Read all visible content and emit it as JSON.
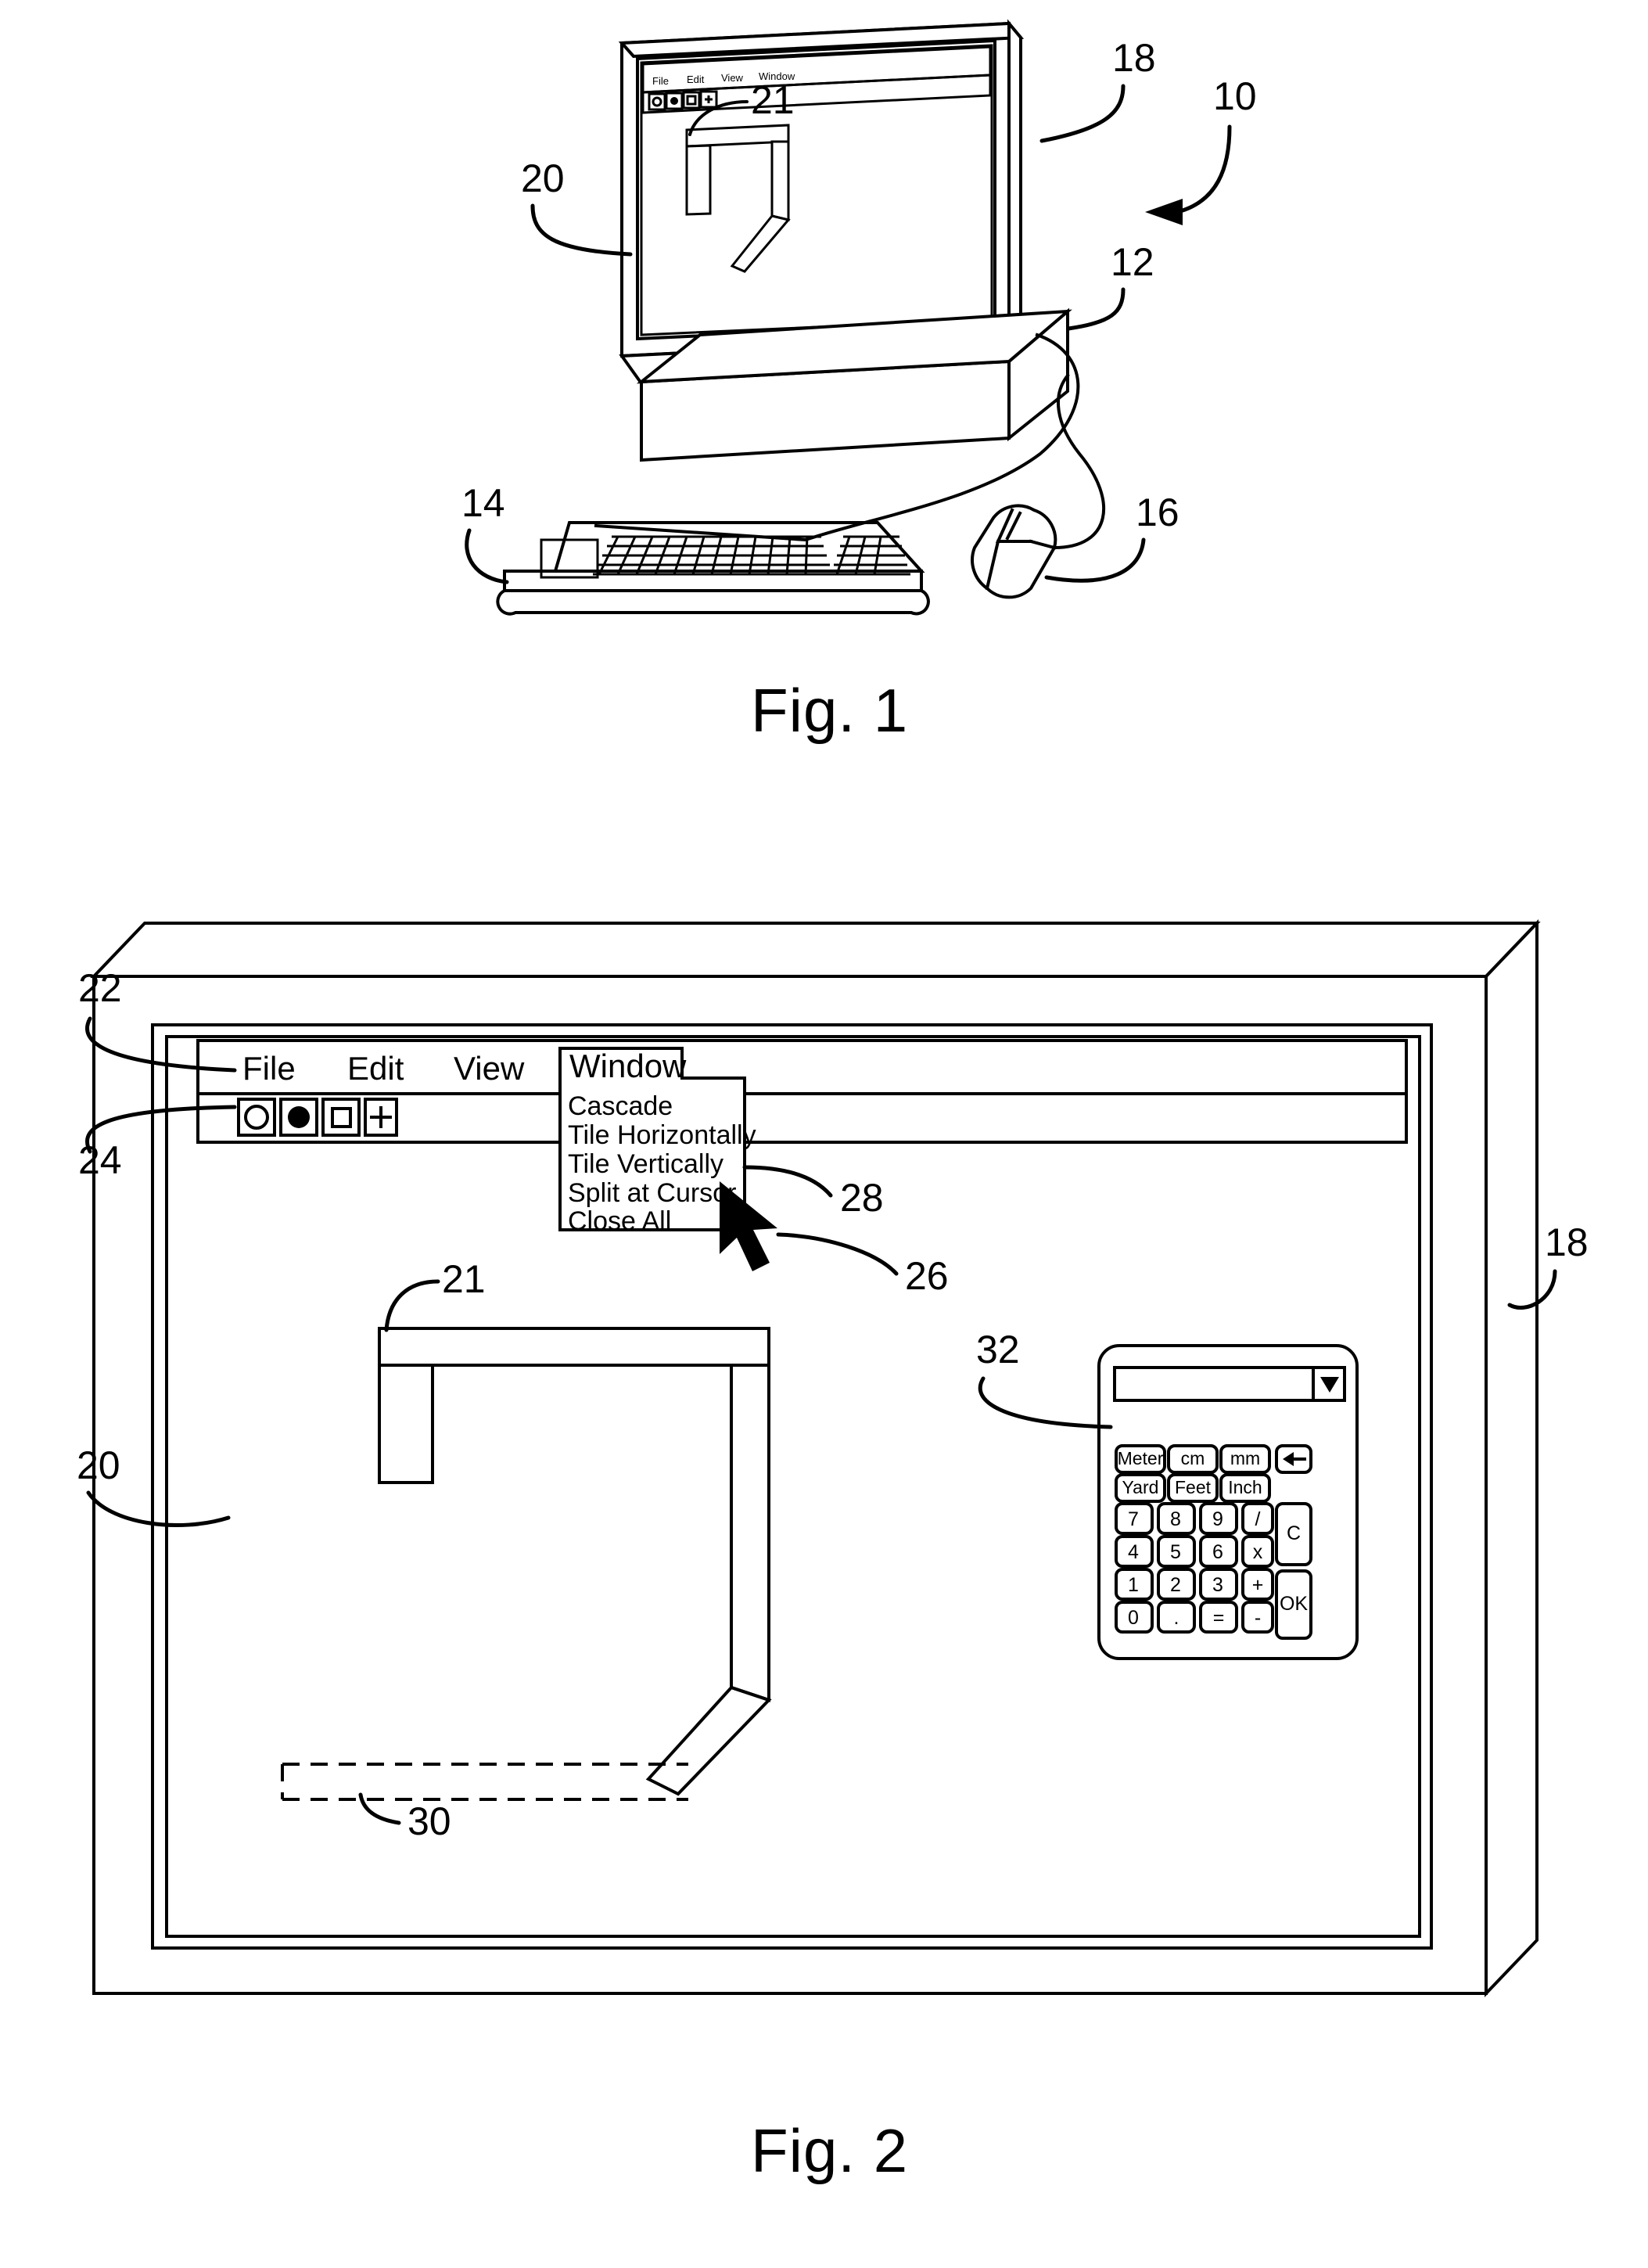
{
  "document": {
    "type": "patent-drawing-sheet",
    "figures": [
      {
        "caption": "Fig. 1"
      },
      {
        "caption": "Fig. 2"
      }
    ]
  },
  "fig1": {
    "caption": "Fig. 1",
    "reference_numerals": [
      {
        "id": "10",
        "label": "10",
        "refers_to": "computer-system"
      },
      {
        "id": "12",
        "label": "12",
        "refers_to": "cpu-housing"
      },
      {
        "id": "14",
        "label": "14",
        "refers_to": "keyboard"
      },
      {
        "id": "16",
        "label": "16",
        "refers_to": "mouse"
      },
      {
        "id": "18",
        "label": "18",
        "refers_to": "monitor"
      },
      {
        "id": "20",
        "label": "20",
        "refers_to": "display-screen"
      },
      {
        "id": "21",
        "label": "21",
        "refers_to": "drawing-object"
      }
    ],
    "screen": {
      "menu_bar": {
        "items": [
          "File",
          "Edit",
          "View",
          "Window"
        ]
      },
      "toolbar": {
        "buttons": [
          {
            "icon": "circle-outline-icon"
          },
          {
            "icon": "circle-filled-icon"
          },
          {
            "icon": "square-outline-icon"
          },
          {
            "icon": "plus-icon"
          }
        ]
      }
    }
  },
  "fig2": {
    "caption": "Fig. 2",
    "reference_numerals": [
      {
        "id": "18",
        "label": "18",
        "refers_to": "monitor"
      },
      {
        "id": "20",
        "label": "20",
        "refers_to": "display-screen"
      },
      {
        "id": "21",
        "label": "21",
        "refers_to": "duct-drawing-object"
      },
      {
        "id": "22",
        "label": "22",
        "refers_to": "menu-bar"
      },
      {
        "id": "24",
        "label": "24",
        "refers_to": "toolbar"
      },
      {
        "id": "26",
        "label": "26",
        "refers_to": "mouse-cursor"
      },
      {
        "id": "28",
        "label": "28",
        "refers_to": "drop-down-menu"
      },
      {
        "id": "30",
        "label": "30",
        "refers_to": "phantom-dashed-segment"
      },
      {
        "id": "32",
        "label": "32",
        "refers_to": "on-screen-calculator"
      }
    ],
    "menu_bar": {
      "items": [
        "File",
        "Edit",
        "View",
        "Window"
      ],
      "active_item": "Window"
    },
    "toolbar": {
      "buttons": [
        {
          "icon": "circle-outline-icon",
          "glyph": "circle-outline"
        },
        {
          "icon": "circle-filled-icon",
          "glyph": "circle-filled"
        },
        {
          "icon": "square-outline-icon",
          "glyph": "square-outline"
        },
        {
          "icon": "plus-icon",
          "glyph": "plus"
        }
      ]
    },
    "window_menu": {
      "title": "Window",
      "items": [
        "Cascade",
        "Tile Horizontally",
        "Tile Vertically",
        "Split at Cursor",
        "Close All"
      ]
    },
    "calculator": {
      "display_value": "",
      "dropdown_icon": "chevron-down-icon",
      "unit_keys": [
        "Meter",
        "cm",
        "mm",
        "Yard",
        "Feet",
        "Inch"
      ],
      "backspace_icon": "backspace-arrow-icon",
      "clear_key": "C",
      "confirm_key": "OK",
      "keypad_rows": [
        [
          "7",
          "8",
          "9",
          "/"
        ],
        [
          "4",
          "5",
          "6",
          "x"
        ],
        [
          "1",
          "2",
          "3",
          "+"
        ],
        [
          "0",
          ".",
          "=",
          "-"
        ]
      ]
    }
  },
  "colors": {
    "ink": "#000000",
    "paper": "#ffffff"
  }
}
